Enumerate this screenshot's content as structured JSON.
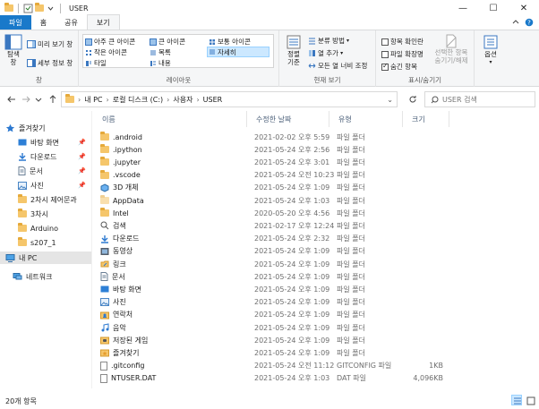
{
  "window": {
    "title": "USER",
    "controls": [
      "—",
      "☐",
      "✕"
    ]
  },
  "ribbon_tabs": [
    "파일",
    "홈",
    "공유",
    "보기"
  ],
  "ribbon": {
    "pane_group": {
      "label": "창",
      "nav_pane": "탐색\n창",
      "preview": "미리 보기 창",
      "details": "세부 정보 창"
    },
    "layout_group": {
      "label": "레이아웃",
      "items": [
        "아주 큰 아이콘",
        "큰 아이콘",
        "보통 아이콘",
        "작은 아이콘",
        "목록",
        "자세히",
        "타일",
        "내용"
      ],
      "selected": "자세히"
    },
    "view_group": {
      "label": "현재 보기",
      "sort": "정렬\n기준",
      "group_by": "분류 방법",
      "add_column": "열 추가",
      "fit_columns": "모든 열 너비 조정"
    },
    "show_group": {
      "label": "표시/숨기기",
      "item_checkbox": "항목 확인란",
      "file_ext": "파일 확장명",
      "hidden_items": "숨긴 항목",
      "hide_selected": "선택한 항목\n숨기기/해제",
      "hidden_checked": true
    },
    "options": "옵션"
  },
  "address": {
    "crumbs": [
      "내 PC",
      "로컬 디스크 (C:)",
      "사용자",
      "USER"
    ],
    "search_placeholder": "USER 검색"
  },
  "nav_pane": {
    "quick_access": "즐겨찾기",
    "items": [
      "바탕 화면",
      "다운로드",
      "문서",
      "사진",
      "2차시 제어문과",
      "3차시",
      "Arduino",
      "s207_1"
    ],
    "this_pc": "내 PC",
    "network": "네트워크"
  },
  "columns": [
    "이름",
    "수정한 날짜",
    "유형",
    "크기"
  ],
  "files": [
    {
      "name": ".android",
      "date": "2021-02-02 오후 5:59",
      "type": "파일 폴더",
      "size": "",
      "icon": "folder"
    },
    {
      "name": ".ipython",
      "date": "2021-05-24 오후 2:56",
      "type": "파일 폴더",
      "size": "",
      "icon": "folder"
    },
    {
      "name": ".jupyter",
      "date": "2021-05-24 오후 3:01",
      "type": "파일 폴더",
      "size": "",
      "icon": "folder"
    },
    {
      "name": ".vscode",
      "date": "2021-05-24 오전 10:23",
      "type": "파일 폴더",
      "size": "",
      "icon": "folder"
    },
    {
      "name": "3D 개체",
      "date": "2021-05-24 오후 1:09",
      "type": "파일 폴더",
      "size": "",
      "icon": "3d"
    },
    {
      "name": "AppData",
      "date": "2021-05-24 오후 1:03",
      "type": "파일 폴더",
      "size": "",
      "icon": "folder-light"
    },
    {
      "name": "Intel",
      "date": "2020-05-20 오후 4:56",
      "type": "파일 폴더",
      "size": "",
      "icon": "folder"
    },
    {
      "name": "검색",
      "date": "2021-02-17 오후 12:24",
      "type": "파일 폴더",
      "size": "",
      "icon": "search"
    },
    {
      "name": "다운로드",
      "date": "2021-05-24 오후 2:32",
      "type": "파일 폴더",
      "size": "",
      "icon": "download"
    },
    {
      "name": "동영상",
      "date": "2021-05-24 오후 1:09",
      "type": "파일 폴더",
      "size": "",
      "icon": "video"
    },
    {
      "name": "링크",
      "date": "2021-05-24 오후 1:09",
      "type": "파일 폴더",
      "size": "",
      "icon": "link"
    },
    {
      "name": "문서",
      "date": "2021-05-24 오후 1:09",
      "type": "파일 폴더",
      "size": "",
      "icon": "doc"
    },
    {
      "name": "바탕 화면",
      "date": "2021-05-24 오후 1:09",
      "type": "파일 폴더",
      "size": "",
      "icon": "desktop"
    },
    {
      "name": "사진",
      "date": "2021-05-24 오후 1:09",
      "type": "파일 폴더",
      "size": "",
      "icon": "pictures"
    },
    {
      "name": "연락처",
      "date": "2021-05-24 오후 1:09",
      "type": "파일 폴더",
      "size": "",
      "icon": "contacts"
    },
    {
      "name": "음악",
      "date": "2021-05-24 오후 1:09",
      "type": "파일 폴더",
      "size": "",
      "icon": "music"
    },
    {
      "name": "저장된 게임",
      "date": "2021-05-24 오후 1:09",
      "type": "파일 폴더",
      "size": "",
      "icon": "games"
    },
    {
      "name": "즐겨찾기",
      "date": "2021-05-24 오후 1:09",
      "type": "파일 폴더",
      "size": "",
      "icon": "favorites"
    },
    {
      "name": ".gitconfig",
      "date": "2021-05-24 오전 11:12",
      "type": "GITCONFIG 파일",
      "size": "1KB",
      "icon": "file"
    },
    {
      "name": "NTUSER.DAT",
      "date": "2021-05-24 오후 1:03",
      "type": "DAT 파일",
      "size": "4,096KB",
      "icon": "file"
    }
  ],
  "status": {
    "count": "20개 항목"
  }
}
